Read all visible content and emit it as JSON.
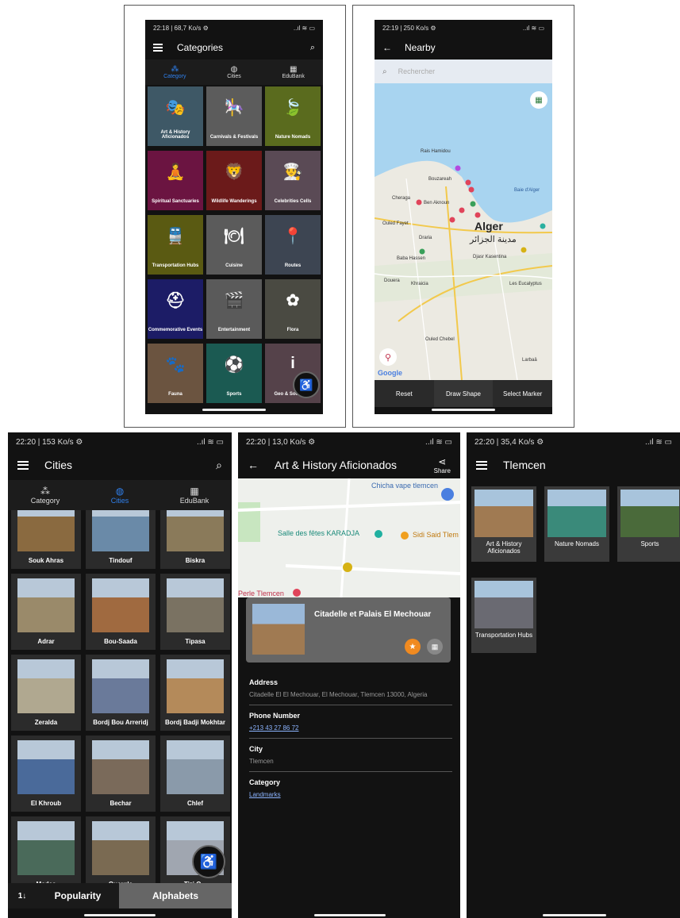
{
  "screen1": {
    "status": "22:18 | 68,7 Ko/s ⚙",
    "status_right": "..ıl ≋ ▭",
    "title": "Categories",
    "tabs": [
      {
        "label": "Category",
        "icon": "sitemap-icon",
        "active": true
      },
      {
        "label": "Cities",
        "icon": "globe-icon",
        "active": false
      },
      {
        "label": "EduBank",
        "icon": "bank-icon",
        "active": false
      }
    ],
    "tiles": [
      {
        "label": "Art & History Aficionados",
        "color": "#3e5866",
        "glyph": "🎭"
      },
      {
        "label": "Carnivals & Festivals",
        "color": "#5c5c5c",
        "glyph": "🎠"
      },
      {
        "label": "Nature Nomads",
        "color": "#5a6b1e",
        "glyph": "🍃"
      },
      {
        "label": "Spiritual Sanctuaries",
        "color": "#6b1441",
        "glyph": "🧘"
      },
      {
        "label": "Wildlife Wanderings",
        "color": "#6b1a1a",
        "glyph": "🦁"
      },
      {
        "label": "Celebrities Cells",
        "color": "#5a4a55",
        "glyph": "👨‍🍳"
      },
      {
        "label": "Transportation Hubs",
        "color": "#5a5a12",
        "glyph": "🚆"
      },
      {
        "label": "Cuisine",
        "color": "#5b5b5b",
        "glyph": "🍽"
      },
      {
        "label": "Routes",
        "color": "#3d4552",
        "glyph": "📍"
      },
      {
        "label": "Commemorative Events",
        "color": "#1c1c66",
        "glyph": "⛑"
      },
      {
        "label": "Entertainment",
        "color": "#5a5a5a",
        "glyph": "🎬"
      },
      {
        "label": "Flora",
        "color": "#4a4a42",
        "glyph": "✿"
      },
      {
        "label": "Fauna",
        "color": "#6b5440",
        "glyph": "🐾"
      },
      {
        "label": "Sports",
        "color": "#1b5a52",
        "glyph": "⚽"
      },
      {
        "label": "Geo & Soci... ...k",
        "color": "#55424a",
        "glyph": "i"
      }
    ]
  },
  "screen2": {
    "status": "22:19 | 250 Ko/s ⚙",
    "status_right": "..ıl ≋ ▭",
    "title": "Nearby",
    "search_placeholder": "Rechercher",
    "map_labels": {
      "rais": "Rais Hamidou",
      "bouzareah": "Bouzareah",
      "cheraga": "Cheraga",
      "aknoun": "Ben Aknoun",
      "alger": "Alger",
      "alger_ar": "مدينة الجزائر",
      "ouled_fayet": "Ouled Fayet",
      "draria": "Draria",
      "baba": "Baba Hassen",
      "djasr": "Djasr Kasentina",
      "douera": "Douera",
      "khraicia": "Khraicia",
      "eucalyptus": "Les Eucalyptus",
      "ouled_chebel": "Ouled Chebel",
      "baie": "Baie d'Alger",
      "larbaa": "Larbaâ",
      "google": "Google"
    },
    "buttons": [
      "Reset",
      "Draw Shape",
      "Select Marker"
    ]
  },
  "screen3": {
    "status": "22:20 | 153 Ko/s ⚙",
    "status_right": "..ıl ≋ ▭",
    "title": "Cities",
    "tabs": [
      {
        "label": "Category",
        "icon": "sitemap-icon",
        "active": false
      },
      {
        "label": "Cities",
        "icon": "globe-icon",
        "active": true
      },
      {
        "label": "EduBank",
        "icon": "bank-icon",
        "active": false
      }
    ],
    "cities": [
      {
        "name": "Souk Ahras",
        "color": "#8a6a40"
      },
      {
        "name": "Tindouf",
        "color": "#6a8aa8"
      },
      {
        "name": "Biskra",
        "color": "#8a7a5a"
      },
      {
        "name": "Adrar",
        "color": "#9a8a6a"
      },
      {
        "name": "Bou-Saada",
        "color": "#a06a40"
      },
      {
        "name": "Tipasa",
        "color": "#7a7262"
      },
      {
        "name": "Zeralda",
        "color": "#b0a890"
      },
      {
        "name": "Bordj Bou Arreridj",
        "color": "#6a7a9a"
      },
      {
        "name": "Bordj Badji Mokhtar",
        "color": "#b48a5a"
      },
      {
        "name": "El Khroub",
        "color": "#4a6a9a"
      },
      {
        "name": "Bechar",
        "color": "#7a6a5a"
      },
      {
        "name": "Chlef",
        "color": "#8a9aaa"
      },
      {
        "name": "Medea",
        "color": "#4a6a5a"
      },
      {
        "name": "Ouargla",
        "color": "#7a6a52"
      },
      {
        "name": "Tizi O...",
        "color": "#a0a6b0"
      }
    ],
    "sort": {
      "popularity": "Popularity",
      "alphabets": "Alphabets",
      "sort_icon": "1↓"
    }
  },
  "screen4": {
    "status": "22:20 | 13,0 Ko/s ⚙",
    "status_right": "..ıl ≋ ▭",
    "title": "Art & History Aficionados",
    "share": "Share",
    "map_labels": {
      "chicha": "Chicha vape tlemcen",
      "salle": "Salle des fêtes KARADJA",
      "sidi": "Sidi Said Tlem",
      "perle": "Perle Tlemcen"
    },
    "place": "Citadelle et Palais El Mechouar",
    "address_label": "Address",
    "address": "Citadelle El El Mechouar, El Mechouar, Tlemcen 13000, Algeria",
    "phone_label": "Phone Number",
    "phone": "+213 43 27 86 72",
    "city_label": "City",
    "city": "Tlemcen",
    "category_label": "Category",
    "category": "Landmarks"
  },
  "screen5": {
    "status": "22:20 | 35,4 Ko/s ⚙",
    "status_right": "..ıl ≋ ▭",
    "title": "Tlemcen",
    "cards": [
      {
        "label": "Art & History Aficionados",
        "color": "#a07a52"
      },
      {
        "label": "Nature Nomads",
        "color": "#3a8a7a"
      },
      {
        "label": "Sports",
        "color": "#4a6a3a"
      },
      {
        "label": "Transportation Hubs",
        "color": "#6a6a72"
      }
    ]
  }
}
